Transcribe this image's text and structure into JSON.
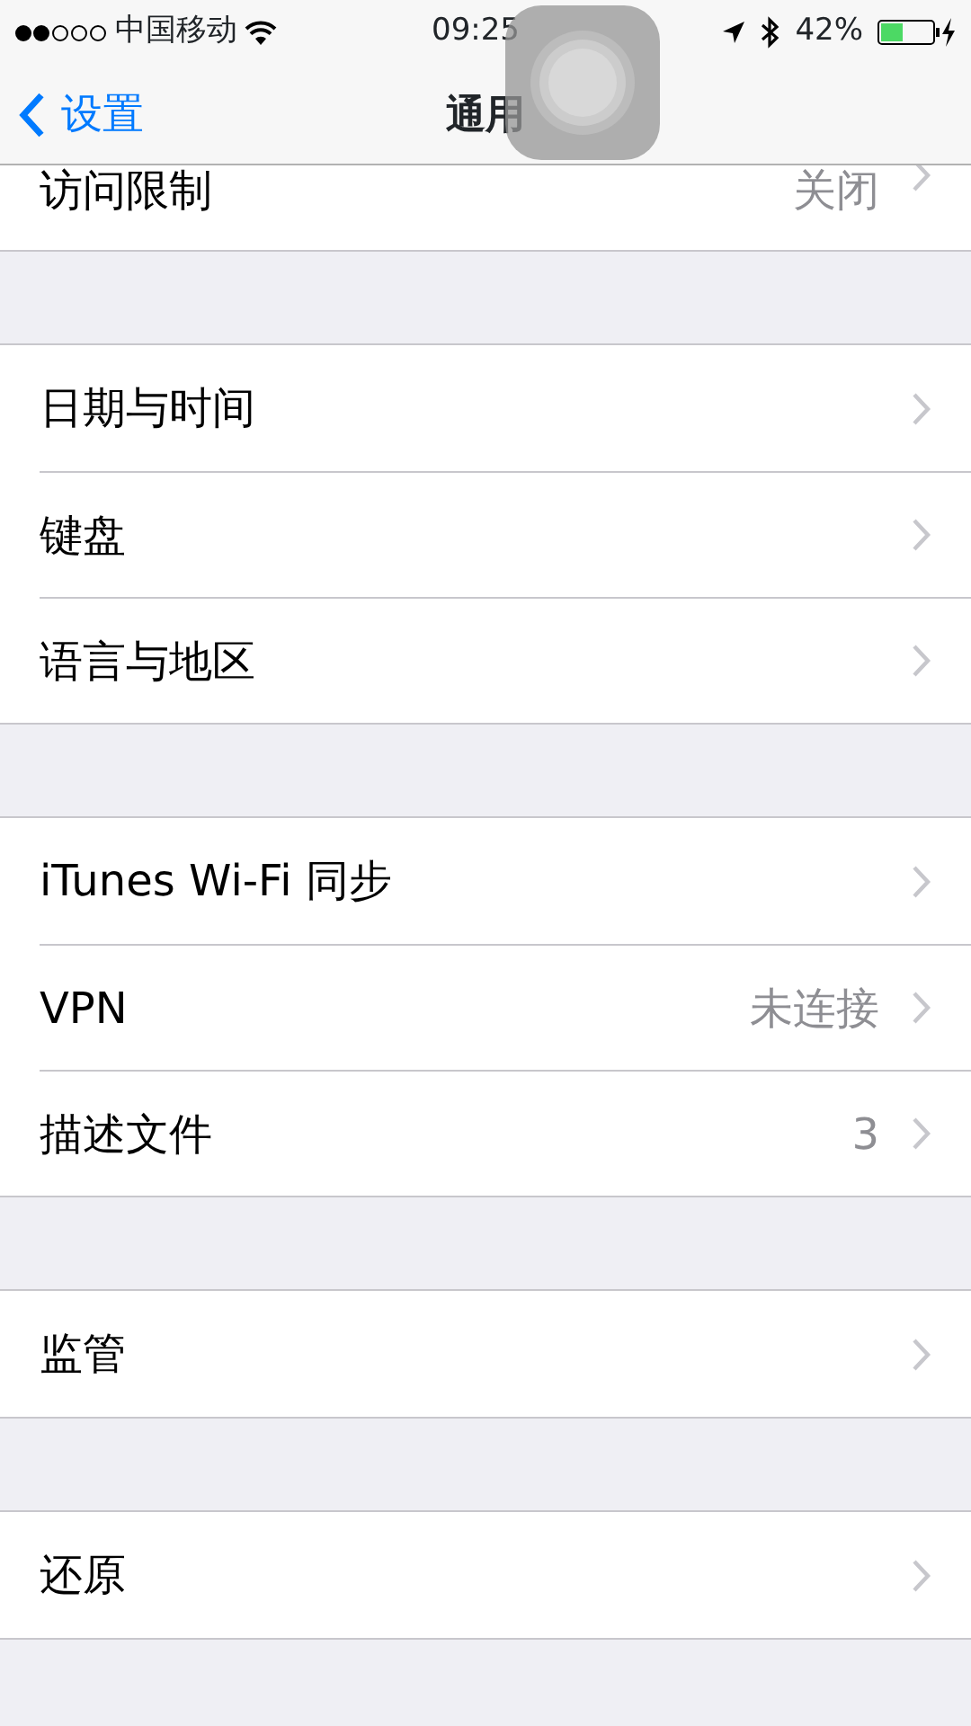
{
  "status_bar": {
    "carrier": "中国移动",
    "time": "09:25",
    "battery": "42%"
  },
  "nav": {
    "back": "设置",
    "title": "通用"
  },
  "sections": [
    {
      "rows": [
        {
          "label": "访问限制",
          "detail": "关闭"
        }
      ]
    },
    {
      "rows": [
        {
          "label": "日期与时间"
        },
        {
          "label": "键盘"
        },
        {
          "label": "语言与地区"
        }
      ]
    },
    {
      "rows": [
        {
          "label": "iTunes Wi-Fi 同步"
        },
        {
          "label": "VPN",
          "detail": "未连接"
        },
        {
          "label": "描述文件",
          "detail": "3"
        }
      ]
    },
    {
      "rows": [
        {
          "label": "监管"
        }
      ]
    },
    {
      "rows": [
        {
          "label": "还原"
        }
      ]
    }
  ]
}
